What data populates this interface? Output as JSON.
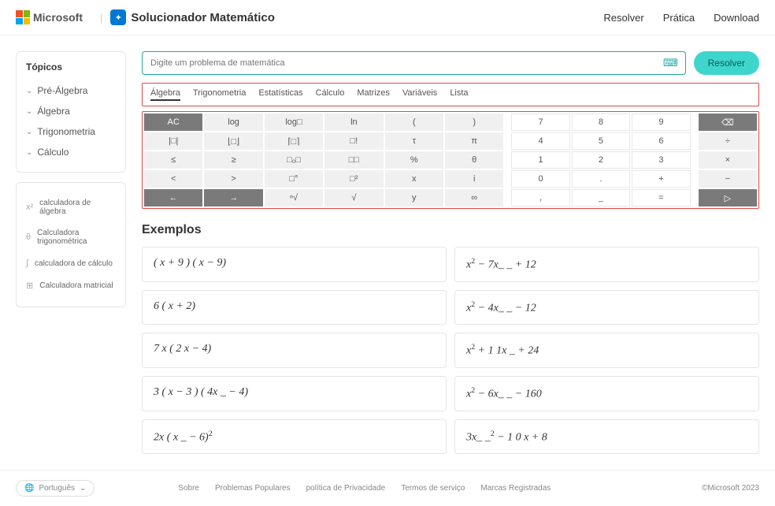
{
  "header": {
    "ms_label": "Microsoft",
    "app_title": "Solucionador Matemático",
    "nav": {
      "resolver": "Resolver",
      "pratica": "Prática",
      "download": "Download"
    }
  },
  "sidebar": {
    "topics_title": "Tópicos",
    "topics": [
      "Pré-Álgebra",
      "Álgebra",
      "Trigonometria",
      "Cálculo"
    ],
    "calcs": [
      {
        "icon": "x²",
        "label": "calculadora de álgebra"
      },
      {
        "icon": "θ",
        "label": "Calculadora trigonométrica"
      },
      {
        "icon": "∫",
        "label": "calculadora de cálculo"
      },
      {
        "icon": "⊞",
        "label": "Calculadora matricial"
      }
    ]
  },
  "search": {
    "placeholder": "Digite um problema de matemática",
    "solve_label": "Resolver"
  },
  "tabs": [
    "Álgebra",
    "Trigonometria",
    "Estatísticas",
    "Cálculo",
    "Matrizes",
    "Variáveis",
    "Lista"
  ],
  "keypad": {
    "rows": [
      [
        "AC",
        "log",
        "log□",
        "ln",
        "(",
        ")",
        "7",
        "8",
        "9",
        "⌫"
      ],
      [
        "|□|",
        "⌊□⌋",
        "⌈□⌉",
        "□!",
        "τ",
        "π",
        "4",
        "5",
        "6",
        "÷"
      ],
      [
        "≤",
        "≥",
        "□₀□",
        "□□",
        "%",
        "θ",
        "1",
        "2",
        "3",
        "×"
      ],
      [
        "<",
        ">",
        "□°",
        "□²",
        "x",
        "i",
        "0",
        ".",
        "+",
        "−"
      ],
      [
        "←",
        "→",
        "ⁿ√",
        "√",
        "y",
        "∞",
        ",",
        "_",
        "=",
        "▷"
      ]
    ]
  },
  "examples": {
    "title": "Exemplos",
    "items": [
      "( x + 9 ) ( x − 9)",
      "x² − 7x_ _ + 12",
      "6 ( x + 2)",
      "x² − 4x_ _ − 12",
      "7 x ( 2 x − 4)",
      "x² + 1 1x _ + 24",
      "3 ( x − 3 ) ( 4x _ − 4)",
      "x² − 6x_ _ − 160",
      "2x ( x _ − 6)²",
      "3x_ _² − 1 0 x + 8"
    ]
  },
  "footer": {
    "lang": "Português",
    "links": [
      "Sobre",
      "Problemas Populares",
      "política de Privacidade",
      "Termos de serviço",
      "Marcas Registradas"
    ],
    "copyright": "©Microsoft 2023"
  }
}
